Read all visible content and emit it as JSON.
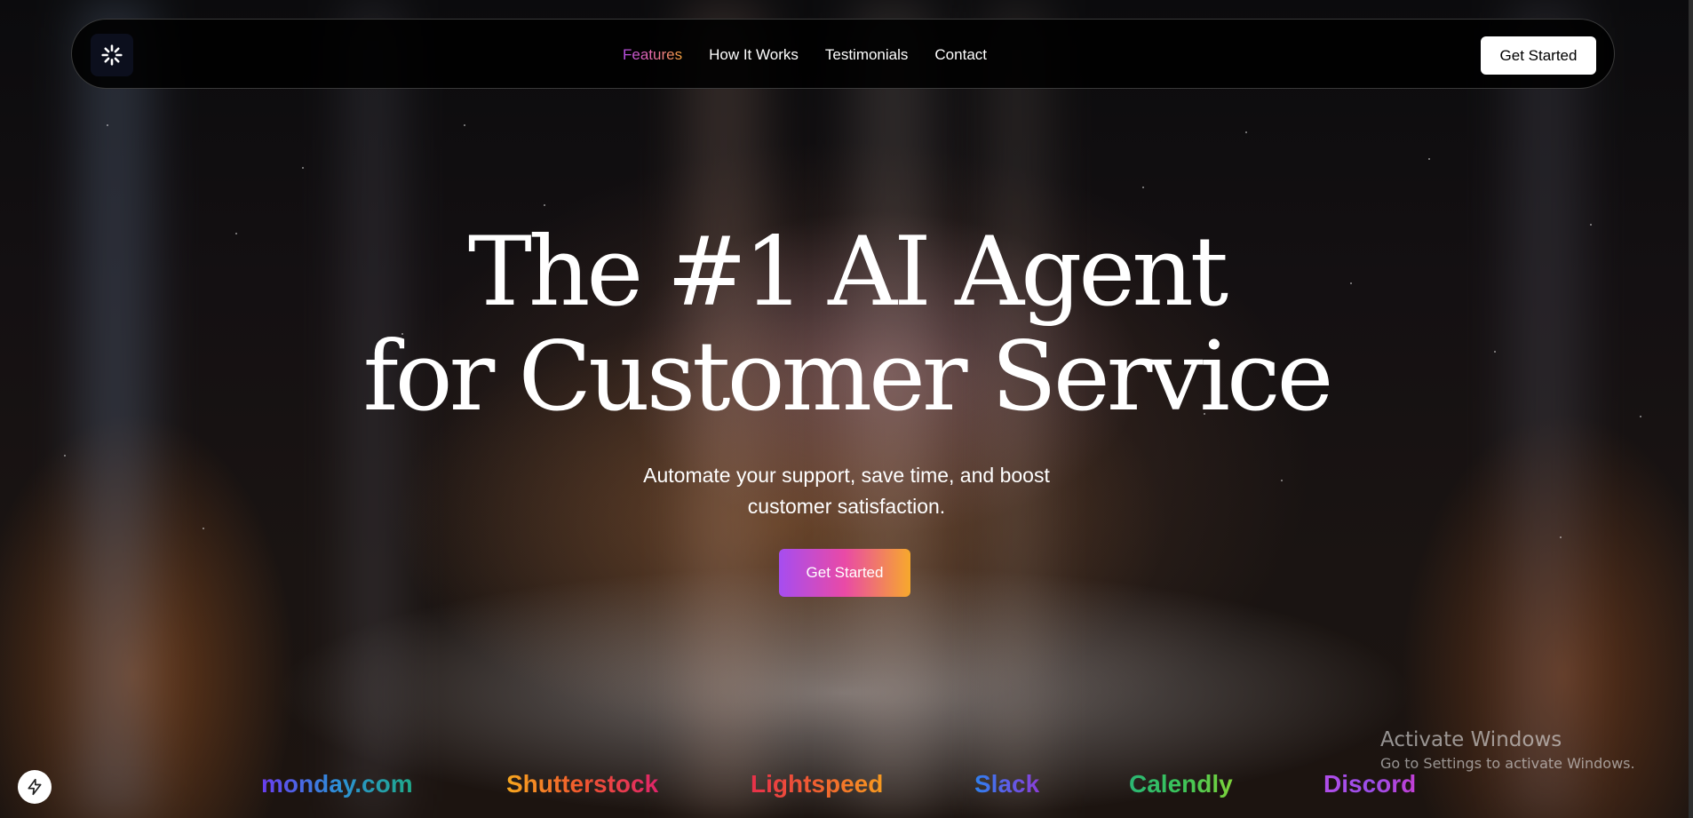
{
  "nav": {
    "logo_icon": "loader-icon",
    "links": [
      {
        "label": "Features",
        "active": true
      },
      {
        "label": "How It Works",
        "active": false
      },
      {
        "label": "Testimonials",
        "active": false
      },
      {
        "label": "Contact",
        "active": false
      }
    ],
    "cta_label": "Get Started"
  },
  "hero": {
    "headline_line1": "The #1 AI Agent",
    "headline_line2": "for Customer Service",
    "subtitle_line1": "Automate your support, save time, and boost",
    "subtitle_line2": "customer satisfaction.",
    "cta_label": "Get Started",
    "cta_gradient": [
      "#a64df0",
      "#e94aa6",
      "#f7a92c"
    ]
  },
  "logos": [
    {
      "label": "monday.com",
      "colors": [
        "#6a3df0",
        "#2d8fd8",
        "#1faa8a"
      ]
    },
    {
      "label": "Shutterstock",
      "colors": [
        "#f7a71e",
        "#f0562e",
        "#e0246a"
      ]
    },
    {
      "label": "Lightspeed",
      "colors": [
        "#e8304a",
        "#f06030",
        "#f79a1f"
      ]
    },
    {
      "label": "Slack",
      "colors": [
        "#2f80ed",
        "#5b5fe8",
        "#8a3fd8"
      ]
    },
    {
      "label": "Calendly",
      "colors": [
        "#2bb673",
        "#3bc45a",
        "#7ed33a"
      ]
    },
    {
      "label": "Discord",
      "colors": [
        "#b04de8",
        "#9a4ee8",
        "#c23fd6"
      ]
    }
  ],
  "badge": {
    "icon": "lightning-icon"
  },
  "watermark": {
    "title": "Activate Windows",
    "subtitle": "Go to Settings to activate Windows."
  },
  "colors": {
    "nav_active_gradient": [
      "#b64de6",
      "#e66aa8",
      "#f6a23c"
    ],
    "background": "#0b0b0d"
  }
}
